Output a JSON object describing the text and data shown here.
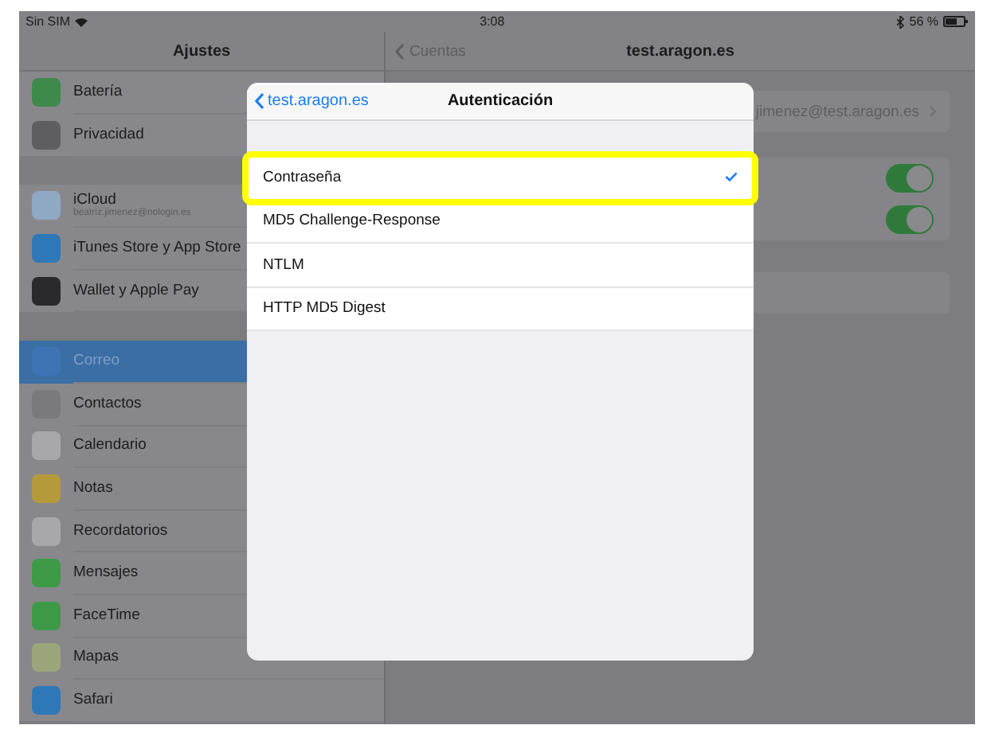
{
  "status_bar": {
    "carrier": "Sin SIM",
    "time": "3:08",
    "battery": "56 %"
  },
  "sidebar": {
    "title": "Ajustes",
    "groups": [
      [
        {
          "label": "Batería",
          "color": "#3d8a4a",
          "selected": false
        },
        {
          "label": "Privacidad",
          "color": "#5e5e62",
          "selected": false
        }
      ],
      [
        {
          "label": "iCloud",
          "subtitle": "beatriz.jimenez@nologin.es",
          "color": "#8fa8c4",
          "selected": false
        },
        {
          "label": "iTunes Store y App Store",
          "color": "#2f78b8",
          "selected": false
        },
        {
          "label": "Wallet y Apple Pay",
          "color": "#2a2a2c",
          "selected": false
        }
      ],
      [
        {
          "label": "Correo",
          "color": "#3f73b4",
          "selected": true
        },
        {
          "label": "Contactos",
          "color": "#7a7a7e",
          "selected": false
        },
        {
          "label": "Calendario",
          "color": "#a8a8ac",
          "selected": false
        },
        {
          "label": "Notas",
          "color": "#b49a3a",
          "selected": false
        },
        {
          "label": "Recordatorios",
          "color": "#a8a8ac",
          "selected": false
        },
        {
          "label": "Mensajes",
          "color": "#3e9a47",
          "selected": false
        },
        {
          "label": "FaceTime",
          "color": "#3e9a47",
          "selected": false
        },
        {
          "label": "Mapas",
          "color": "#9aa67a",
          "selected": false
        },
        {
          "label": "Safari",
          "color": "#2f78b8",
          "selected": false
        }
      ]
    ]
  },
  "detail": {
    "back": "Cuentas",
    "title": "test.aragon.es",
    "account": "jimenez@test.aragon.es",
    "toggles": [
      {
        "on": true
      },
      {
        "on": true
      }
    ]
  },
  "dialog": {
    "back": "test.aragon.es",
    "title": "Autenticación",
    "options": [
      {
        "label": "Contraseña",
        "selected": true,
        "highlighted": true
      },
      {
        "label": "MD5 Challenge-Response",
        "selected": false,
        "highlighted": false
      },
      {
        "label": "NTLM",
        "selected": false,
        "highlighted": false
      },
      {
        "label": "HTTP MD5 Digest",
        "selected": false,
        "highlighted": false
      }
    ]
  }
}
